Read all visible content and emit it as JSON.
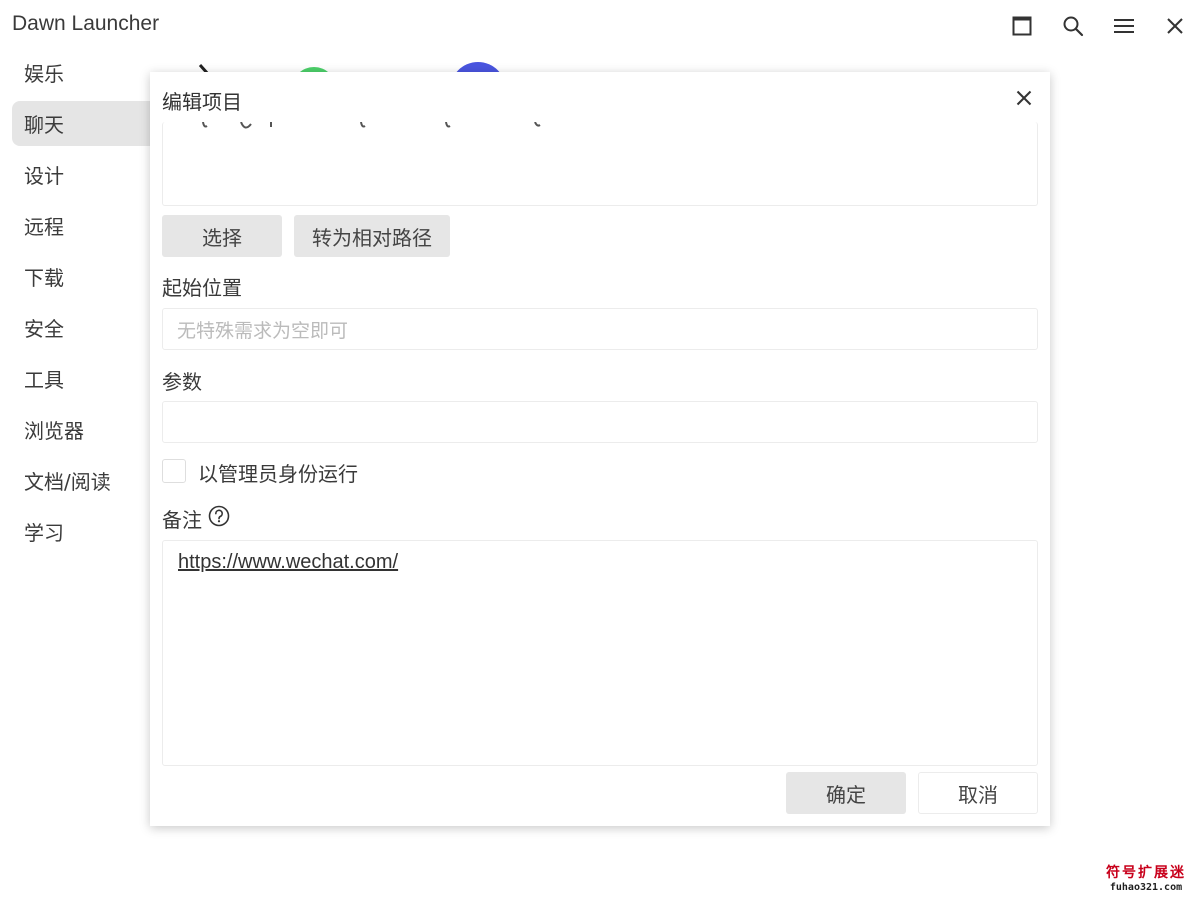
{
  "app": {
    "title": "Dawn Launcher"
  },
  "sidebar": {
    "items": [
      {
        "label": "娱乐",
        "active": false
      },
      {
        "label": "聊天",
        "active": true
      },
      {
        "label": "设计",
        "active": false
      },
      {
        "label": "远程",
        "active": false
      },
      {
        "label": "下载",
        "active": false
      },
      {
        "label": "安全",
        "active": false
      },
      {
        "label": "工具",
        "active": false
      },
      {
        "label": "浏览器",
        "active": false
      },
      {
        "label": "文档/阅读",
        "active": false
      },
      {
        "label": "学习",
        "active": false
      }
    ]
  },
  "title_bar": {
    "icons": [
      "maximize-icon",
      "search-icon",
      "menu-icon",
      "close-icon"
    ]
  },
  "background_icons": {
    "colors": {
      "green": "#4cd06a",
      "blue": "#4a55e0"
    }
  },
  "dialog": {
    "title": "编辑项目",
    "select_button": "选择",
    "relative_path_button": "转为相对路径",
    "start_location_label": "起始位置",
    "start_location_placeholder": "无特殊需求为空即可",
    "start_location_value": "",
    "params_label": "参数",
    "params_value": "",
    "run_as_admin_label": "以管理员身份运行",
    "run_as_admin_checked": false,
    "note_label": "备注",
    "note_value": "https://www.wechat.com/",
    "ok_button": "确定",
    "cancel_button": "取消"
  },
  "watermark": {
    "cn": "符号扩展迷",
    "en": "fuhao321.com"
  }
}
